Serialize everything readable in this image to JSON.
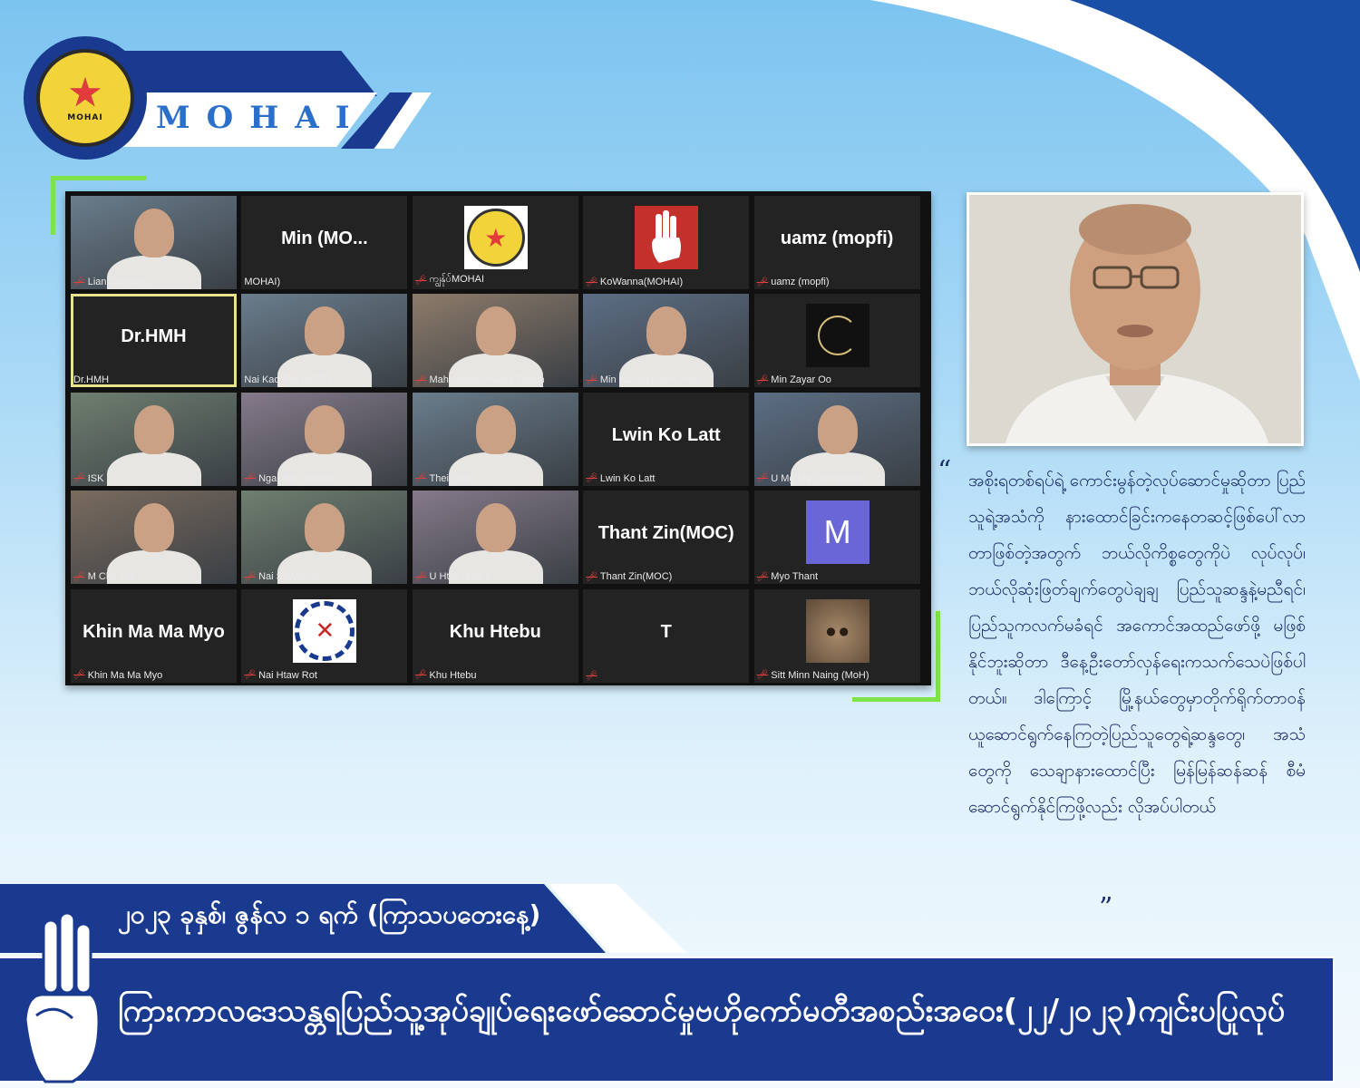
{
  "brand": {
    "title": "MOHAI",
    "accent": "#1a3a8f",
    "highlight": "#7ee34a"
  },
  "participants": [
    {
      "tile_name": "",
      "label": "Lian Sakhong",
      "muted": true,
      "kind": "video"
    },
    {
      "tile_name": "Min  (MO...",
      "label": "MOHAI)",
      "muted": false,
      "kind": "name"
    },
    {
      "tile_name": "",
      "label": "ကျွန်ုပ်MOHAI",
      "muted": true,
      "kind": "logo"
    },
    {
      "tile_name": "",
      "label": "KoWanna(MOHAI)",
      "muted": true,
      "kind": "salute"
    },
    {
      "tile_name": "uamz (mopfi)",
      "label": "uamz (mopfi)",
      "muted": true,
      "kind": "name"
    },
    {
      "tile_name": "Dr.HMH",
      "label": "Dr.HMH",
      "muted": false,
      "kind": "name",
      "selected": true
    },
    {
      "tile_name": "",
      "label": "Nai Kao Rot (MOD)",
      "muted": false,
      "kind": "video"
    },
    {
      "tile_name": "",
      "label": "Mahn Winn Khaing Thann",
      "muted": true,
      "kind": "video"
    },
    {
      "tile_name": "",
      "label": "Min Naung Khine (MoJ)",
      "muted": true,
      "kind": "video"
    },
    {
      "tile_name": "",
      "label": "Min Zayar Oo",
      "muted": true,
      "kind": "dark"
    },
    {
      "tile_name": "",
      "label": "ISK",
      "muted": true,
      "kind": "video"
    },
    {
      "tile_name": "",
      "label": "Ngai Tam Maung",
      "muted": true,
      "kind": "video"
    },
    {
      "tile_name": "",
      "label": "Thein Oo",
      "muted": true,
      "kind": "video"
    },
    {
      "tile_name": "Lwin Ko Latt",
      "label": "Lwin Ko Latt",
      "muted": true,
      "kind": "name"
    },
    {
      "tile_name": "",
      "label": "U Mg Mg Swe(MOD)",
      "muted": true,
      "kind": "video"
    },
    {
      "tile_name": "",
      "label": "M Chit Tun",
      "muted": true,
      "kind": "video"
    },
    {
      "tile_name": "",
      "label": "Nai SuWunna",
      "muted": true,
      "kind": "video"
    },
    {
      "tile_name": "",
      "label": "U Htay (MoL)",
      "muted": true,
      "kind": "video"
    },
    {
      "tile_name": "Thant Zin(MOC)",
      "label": "Thant Zin(MOC)",
      "muted": true,
      "kind": "name"
    },
    {
      "tile_name": "",
      "label": "Myo Thant",
      "muted": true,
      "kind": "avatar",
      "initial": "M"
    },
    {
      "tile_name": "Khin Ma Ma Myo",
      "label": "Khin Ma Ma Myo",
      "muted": true,
      "kind": "name"
    },
    {
      "tile_name": "",
      "label": "Nai Htaw Rot",
      "muted": true,
      "kind": "emblem"
    },
    {
      "tile_name": "Khu Htebu",
      "label": "Khu Htebu",
      "muted": true,
      "kind": "name"
    },
    {
      "tile_name": "T",
      "label": "",
      "muted": true,
      "kind": "name"
    },
    {
      "tile_name": "",
      "label": "Sitt Minn Naing (MoH)",
      "muted": true,
      "kind": "cat"
    }
  ],
  "quote": {
    "open": "“",
    "close": "”",
    "text": "အစိုးရတစ်ရပ်ရဲ့ ကောင်းမွန်တဲ့လုပ်ဆောင်မှုဆိုတာ ပြည်သူရဲ့အသံကို နားထောင်ခြင်းကနေတဆင့်ဖြစ်ပေါ်လာတာဖြစ်တဲ့အတွက် ဘယ်လိုကိစ္စတွေကိုပဲ လုပ်လုပ်၊ ဘယ်လိုဆုံးဖြတ်ချက်တွေပဲချချ ပြည်သူဆန္ဒနဲ့မညီရင်၊ ပြည်သူကလက်မခံရင် အကောင်အထည်ဖော်ဖို့ မဖြစ်နိုင်ဘူးဆိုတာ ဒီနေ့ဦးတော်လှန်ရေးကသက်သေပဲဖြစ်ပါတယ်။ ဒါကြောင့် မြို့နယ်တွေမှာတိုက်ရိုက်တာဝန်ယူဆောင်ရွက်နေကြတဲ့ပြည်သူတွေရဲ့ဆန္ဒတွေ၊ အသံတွေကို သေချာနားထောင်ပြီး မြန်မြန်ဆန်ဆန် စီမံ ဆောင်ရွက်နိုင်ကြဖို့လည်း လိုအပ်ပါတယ်"
  },
  "date_banner": "၂၀၂၃ ခုနှစ်၊ ဇွန်လ ၁ ရက် (ကြာသပတေးနေ့)",
  "bottom_banner": "ကြားကာလဒေသန္တရပြည်သူ့အုပ်ချုပ်ရေးဖော်ဆောင်မှုဗဟိုကော်မတီအစည်းအဝေး(၂၂/၂၀၂၃)ကျင်းပပြုလုပ်"
}
